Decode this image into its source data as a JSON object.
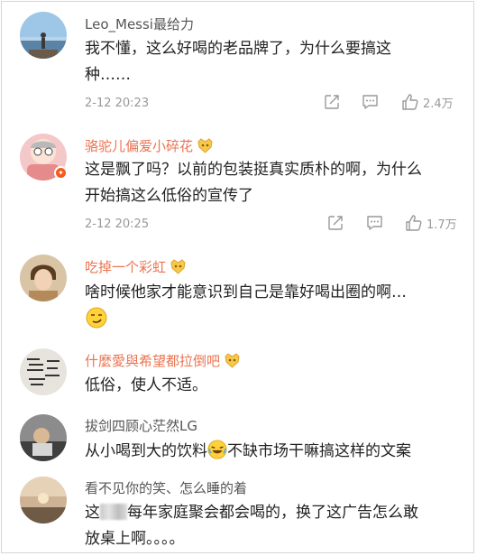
{
  "comments": [
    {
      "username": "Leo_Messi最给力",
      "text_line1": "我不懂，这么好喝的老品牌了，为什么要搞这",
      "text_line2": "种……",
      "time": "2-12 20:23",
      "likes": "2.4万"
    },
    {
      "username": "骆驼儿偏爱小碎花",
      "text_line1": "这是飘了吗？以前的包装挺真实质朴的啊，为什么",
      "text_line2": "开始搞这么低俗的宣传了",
      "time": "2-12 20:25",
      "likes": "1.7万"
    },
    {
      "username": "吃掉一个彩虹",
      "text_line1": "啥时候他家才能意识到自己是靠好喝出圈的啊…"
    },
    {
      "username": "什麼愛與希望都拉倒吧",
      "text_line1": "低俗，使人不适。"
    },
    {
      "username": "拔剑四顾心茫然LG",
      "text_before_emoji": "从小喝到大的饮料",
      "text_after_emoji": "不缺市场干嘛搞这样的文案"
    },
    {
      "username": "看不见你的笑、怎么睡的着",
      "text_before_blur": "这",
      "text_after_blur": "每年家庭聚会都会喝的，换了这广告怎么敢",
      "text_line2": "放桌上啊。。。。"
    }
  ],
  "icons": {
    "repost": "repost-icon",
    "comment": "comment-icon",
    "like": "thumbs-up-icon",
    "medal": "fan-medal-icon",
    "verified": "verified-badge-icon"
  },
  "colors": {
    "vip_name": "#eb7350",
    "name": "#555555",
    "meta": "#999999"
  }
}
